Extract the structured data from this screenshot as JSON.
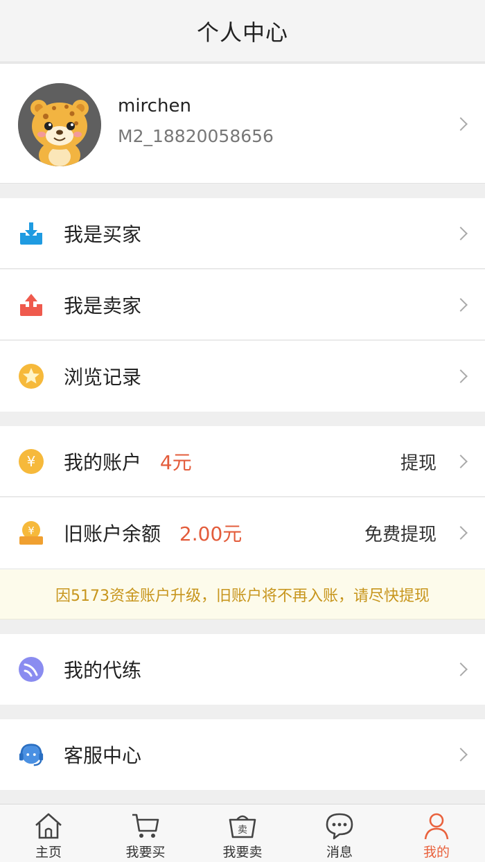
{
  "header": {
    "title": "个人中心"
  },
  "profile": {
    "name": "mirchen",
    "id": "M2_18820058656"
  },
  "menu_group1": [
    {
      "label": "我是买家",
      "icon": "download-tray-icon"
    },
    {
      "label": "我是卖家",
      "icon": "upload-tray-icon"
    },
    {
      "label": "浏览记录",
      "icon": "star-icon"
    }
  ],
  "account": {
    "label": "我的账户",
    "amount": "4元",
    "action": "提现"
  },
  "old_account": {
    "label": "旧账户余额",
    "amount": "2.00元",
    "action": "免费提现"
  },
  "notice": "因5173资金账户升级，旧账户将不再入账，请尽快提现",
  "boosting": {
    "label": "我的代练"
  },
  "support": {
    "label": "客服中心"
  },
  "tabs": [
    {
      "label": "主页",
      "icon": "home-icon"
    },
    {
      "label": "我要买",
      "icon": "cart-icon"
    },
    {
      "label": "我要卖",
      "icon": "sell-basket-icon",
      "glyph": "卖"
    },
    {
      "label": "消息",
      "icon": "chat-bubble-icon"
    },
    {
      "label": "我的",
      "icon": "user-icon",
      "active": true
    }
  ],
  "colors": {
    "accent": "#e9613c",
    "amount": "#e35c3b",
    "notice_text": "#c7951c",
    "notice_bg": "#fdfbeb"
  }
}
